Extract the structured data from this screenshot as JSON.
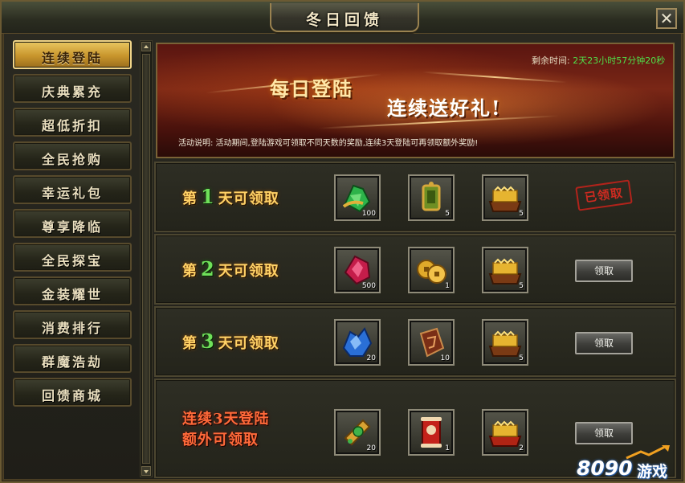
{
  "window": {
    "title": "冬日回馈",
    "close_label": "✕"
  },
  "sidebar": {
    "items": [
      {
        "label": "连续登陆",
        "active": true
      },
      {
        "label": "庆典累充"
      },
      {
        "label": "超低折扣"
      },
      {
        "label": "全民抢购"
      },
      {
        "label": "幸运礼包"
      },
      {
        "label": "尊享降临"
      },
      {
        "label": "全民探宝"
      },
      {
        "label": "金装耀世"
      },
      {
        "label": "消费排行"
      },
      {
        "label": "群魔浩劫"
      },
      {
        "label": "回馈商城"
      }
    ]
  },
  "banner": {
    "headline": "每日登陆",
    "subheadline": "连续送好礼!",
    "timer_label": "剩余时间:",
    "timer_value": "2天23小时57分钟20秒",
    "description": "活动说明:  活动期间,登陆游戏可领取不同天数的奖励,连续3天登陆可再领取额外奖励!"
  },
  "rows": [
    {
      "label_prefix": "第",
      "day": "1",
      "label_suffix": "天可领取",
      "items": [
        {
          "icon": "green-gem-icon",
          "count": "100"
        },
        {
          "icon": "jade-token-icon",
          "count": "5"
        },
        {
          "icon": "gold-chest-icon",
          "count": "5"
        }
      ],
      "status": "已领取"
    },
    {
      "label_prefix": "第",
      "day": "2",
      "label_suffix": "天可领取",
      "items": [
        {
          "icon": "red-crystal-icon",
          "count": "500"
        },
        {
          "icon": "gold-coin-icon",
          "count": "1"
        },
        {
          "icon": "gold-chest-icon",
          "count": "5"
        }
      ],
      "button": "领取"
    },
    {
      "label_prefix": "第",
      "day": "3",
      "label_suffix": "天可领取",
      "items": [
        {
          "icon": "blue-crystal-icon",
          "count": "20"
        },
        {
          "icon": "rune-stone-icon",
          "count": "10"
        },
        {
          "icon": "gold-chest-icon",
          "count": "5"
        }
      ],
      "button": "领取"
    },
    {
      "bonus_line1": "连续3天登陆",
      "bonus_line2": "额外可领取",
      "items": [
        {
          "icon": "jade-pendant-icon",
          "count": "20"
        },
        {
          "icon": "red-scroll-icon",
          "count": "1"
        },
        {
          "icon": "red-chest-icon",
          "count": "2"
        }
      ],
      "button": "领取"
    }
  ],
  "watermark": {
    "number": "8090",
    "text": "游戏"
  }
}
